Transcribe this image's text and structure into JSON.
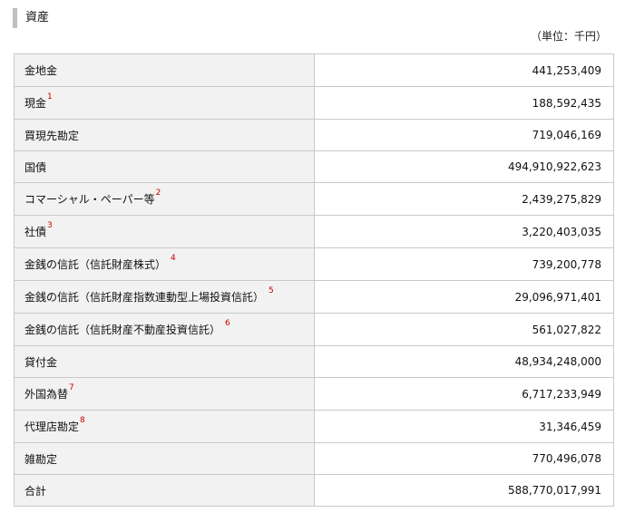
{
  "section": {
    "title": "資産",
    "unit": "（単位：千円）"
  },
  "rows": [
    {
      "label": "金地金",
      "note": "",
      "value": "441,253,409"
    },
    {
      "label": "現金",
      "note": "1",
      "value": "188,592,435"
    },
    {
      "label": "買現先勘定",
      "note": "",
      "value": "719,046,169"
    },
    {
      "label": "国債",
      "note": "",
      "value": "494,910,922,623"
    },
    {
      "label": "コマーシャル・ペーパー等",
      "note": "2",
      "value": "2,439,275,829"
    },
    {
      "label": "社債",
      "note": "3",
      "value": "3,220,403,035"
    },
    {
      "label": "金銭の信託（信託財産株式）",
      "note": "4",
      "value": "739,200,778"
    },
    {
      "label": "金銭の信託（信託財産指数連動型上場投資信託）",
      "note": "5",
      "value": "29,096,971,401"
    },
    {
      "label": "金銭の信託（信託財産不動産投資信託）",
      "note": "6",
      "value": "561,027,822"
    },
    {
      "label": "貸付金",
      "note": "",
      "value": "48,934,248,000"
    },
    {
      "label": "外国為替",
      "note": "7",
      "value": "6,717,233,949"
    },
    {
      "label": "代理店勘定",
      "note": "8",
      "value": "31,346,459"
    },
    {
      "label": "雑勘定",
      "note": "",
      "value": "770,496,078"
    },
    {
      "label": "合計",
      "note": "",
      "value": "588,770,017,991"
    }
  ],
  "colors": {
    "label_bg": "#f2f2f2",
    "border": "#c9c9c9",
    "note": "#cc0000",
    "title_bar": "#bfbfbf"
  }
}
